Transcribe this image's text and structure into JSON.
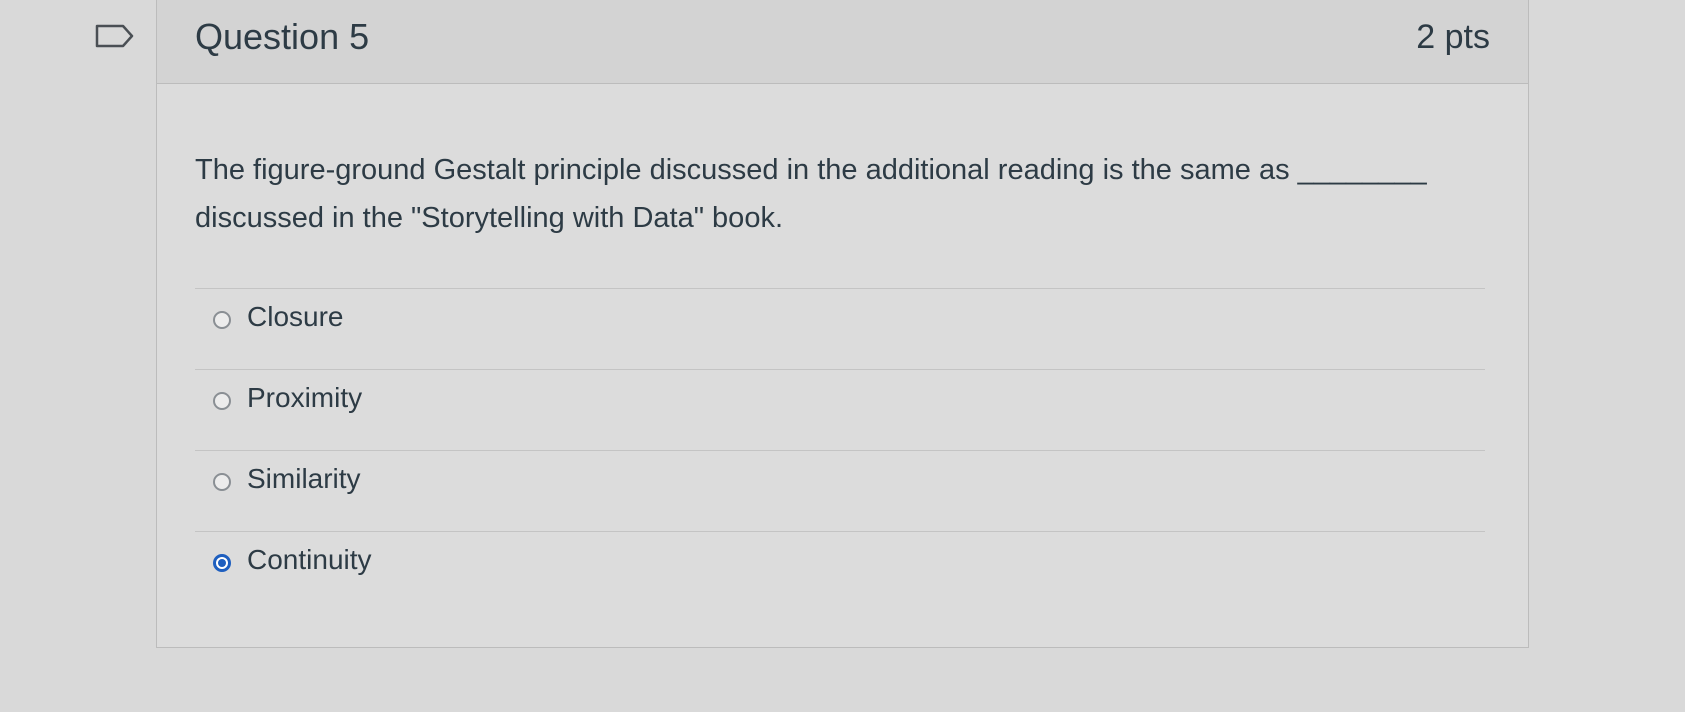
{
  "question": {
    "title": "Question 5",
    "points": "2 pts",
    "text": "The figure-ground Gestalt principle discussed in the additional reading is the same as ________ discussed in the \"Storytelling with Data\" book."
  },
  "answers": [
    {
      "label": "Closure",
      "selected": false
    },
    {
      "label": "Proximity",
      "selected": false
    },
    {
      "label": "Similarity",
      "selected": false
    },
    {
      "label": "Continuity",
      "selected": true
    }
  ],
  "icons": {
    "flag": "bookmark-flag-icon"
  },
  "colors": {
    "selected_radio": "#1e5fbf",
    "text": "#2d3b45"
  }
}
